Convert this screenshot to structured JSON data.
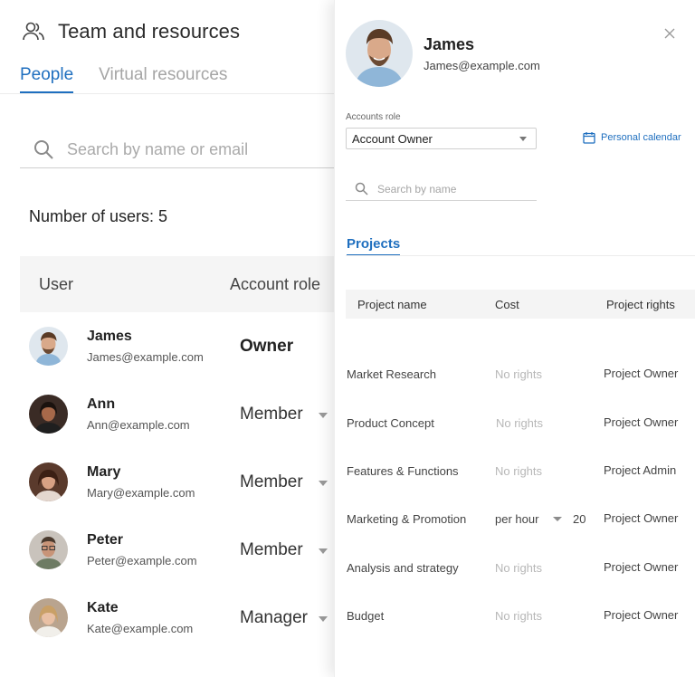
{
  "app": {
    "title": "Team and resources",
    "tabs": [
      {
        "label": "People",
        "active": true
      },
      {
        "label": "Virtual resources",
        "active": false
      }
    ],
    "search_placeholder": "Search by name or email",
    "users_count_label": "Number of users: 5",
    "table_headers": {
      "user": "User",
      "role": "Account role"
    },
    "users": [
      {
        "name": "James",
        "email": "James@example.com",
        "role": "Owner",
        "has_dropdown": false
      },
      {
        "name": "Ann",
        "email": "Ann@example.com",
        "role": "Member",
        "has_dropdown": true
      },
      {
        "name": "Mary",
        "email": "Mary@example.com",
        "role": "Member",
        "has_dropdown": true
      },
      {
        "name": "Peter",
        "email": "Peter@example.com",
        "role": "Member",
        "has_dropdown": true
      },
      {
        "name": "Kate",
        "email": "Kate@example.com",
        "role": "Manager",
        "has_dropdown": true
      }
    ]
  },
  "panel": {
    "name": "James",
    "email": "James@example.com",
    "role_label": "Accounts role",
    "role_value": "Account Owner",
    "personal_calendar": "Personal calendar",
    "search_placeholder": "Search by name",
    "tab_projects": "Projects",
    "table_headers": {
      "name": "Project name",
      "cost": "Cost",
      "rights": "Project rights"
    },
    "projects": [
      {
        "name": "Market Research",
        "cost": "No rights",
        "rights": "Project Owner"
      },
      {
        "name": "Product Concept",
        "cost": "No rights",
        "rights": "Project Owner"
      },
      {
        "name": "Features & Functions",
        "cost": "No rights",
        "rights": "Project Admin"
      },
      {
        "name": "Marketing & Promotion",
        "cost": "per hour",
        "rate": "20",
        "rights": "Project Owner"
      },
      {
        "name": "Analysis and strategy",
        "cost": "No rights",
        "rights": "Project Owner"
      },
      {
        "name": "Budget",
        "cost": "No rights",
        "rights": "Project Owner"
      }
    ]
  },
  "colors": {
    "accent": "#1f6fbf",
    "muted_text": "#a5a5a5",
    "header_bg": "#f5f5f5"
  },
  "icons": {
    "team": "people-icon",
    "search": "search-icon",
    "close": "close-icon",
    "calendar": "calendar-icon",
    "dropdown": "chevron-down-icon"
  }
}
